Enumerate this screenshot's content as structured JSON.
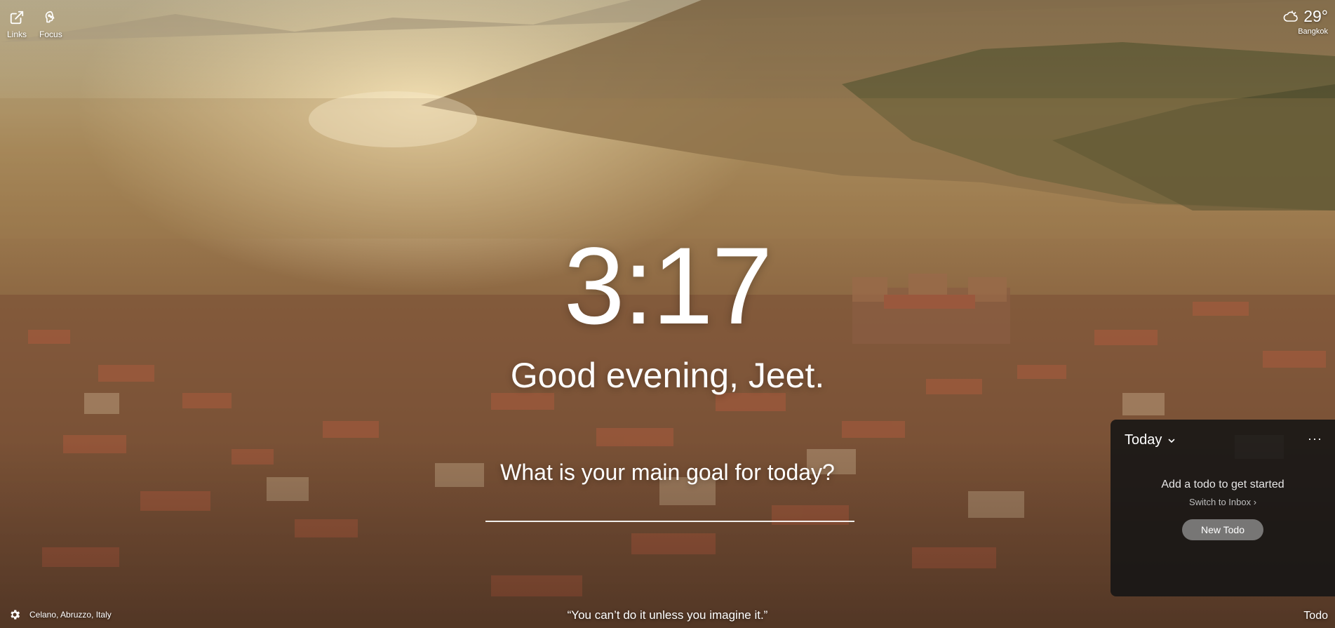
{
  "top_left": {
    "links_label": "Links",
    "focus_label": "Focus",
    "links_icon": "external-link-icon",
    "focus_icon": "brain-icon"
  },
  "weather": {
    "temperature": "29°",
    "location": "Bangkok",
    "icon": "cloud-sun-icon"
  },
  "center": {
    "time": "3:17",
    "greeting": "Good evening, Jeet.",
    "goal_prompt": "What is your main goal for today?",
    "goal_input_value": ""
  },
  "todo_panel": {
    "title": "Today",
    "more_label": "···",
    "empty_message": "Add a todo to get started",
    "switch_label": "Switch to Inbox ›",
    "new_button_label": "New Todo"
  },
  "bottom": {
    "photo_location": "Celano, Abruzzo, Italy",
    "quote": "“You can’t do it unless you imagine it.”",
    "todo_toggle_label": "Todo",
    "settings_icon": "gear-icon"
  },
  "colors": {
    "panel_bg": "#141414",
    "button_bg": "#969696",
    "text": "#ffffff"
  }
}
